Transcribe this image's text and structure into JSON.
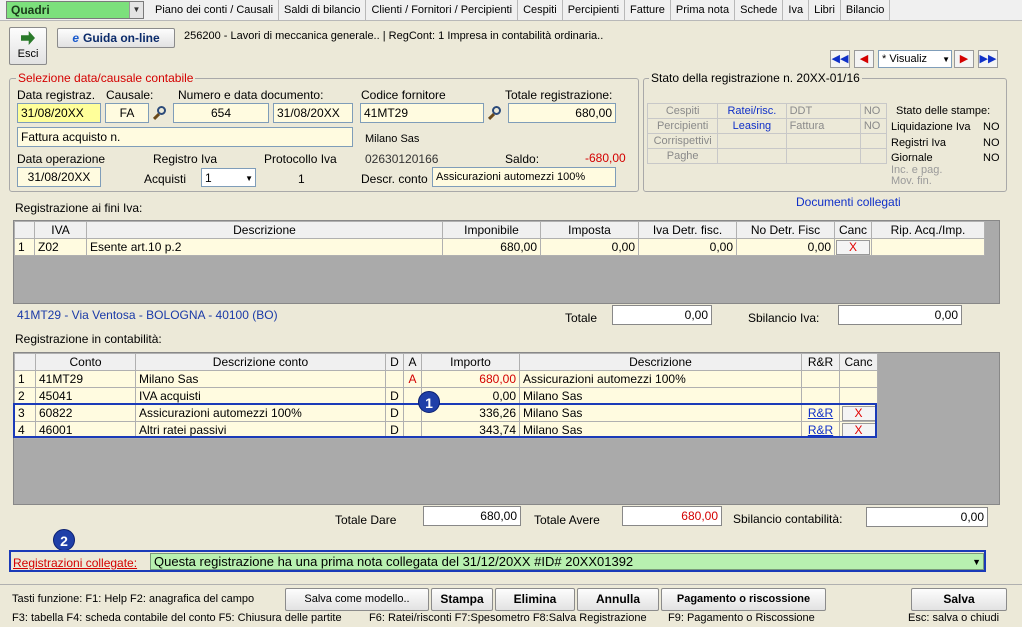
{
  "menubar": {
    "combo_value": "Quadri",
    "items": [
      "Piano dei conti / Causali",
      "Saldi di bilancio",
      "Clienti / Fornitori / Percipienti",
      "Cespiti",
      "Percipienti",
      "Fatture",
      "Prima nota",
      "Schede",
      "Iva",
      "Libri",
      "Bilancio"
    ]
  },
  "toolbar": {
    "esci_label": "Esci",
    "guida_label": "Guida on-line",
    "info_text": "256200 - Lavori di meccanica generale.. | RegCont: 1 Impresa  in contabilità ordinaria..",
    "nav_select": "* Visualiz"
  },
  "selezione": {
    "title": "Selezione data/causale contabile",
    "data_registraz_label": "Data registraz.",
    "data_registraz": "31/08/20XX",
    "causale_label": "Causale:",
    "causale": "FA",
    "numero_data_label": "Numero e data documento:",
    "numero_doc": "654",
    "data_doc": "31/08/20XX",
    "descrizione": "Fattura acquisto n.",
    "data_operazione_label": "Data operazione",
    "data_operazione": "31/08/20XX",
    "registro_iva_label": "Registro Iva",
    "acquisti_label": "Acquisti",
    "registro_iva": "1",
    "protocollo_label": "Protocollo Iva",
    "protocollo": "1",
    "codice_fornitore_label": "Codice fornitore",
    "codice_fornitore": "41MT29",
    "totale_label": "Totale registrazione:",
    "totale": "680,00",
    "fornitore_nome": "Milano Sas",
    "fornitore_piva": "02630120166",
    "saldo_label": "Saldo:",
    "saldo": "-680,00",
    "descr_conto_label": "Descr. conto",
    "descr_conto": "Assicurazioni automezzi 100%"
  },
  "stato": {
    "title": "Stato della registrazione n. 20XX-01/16",
    "rows": [
      [
        "Cespiti",
        "Ratei/risc.",
        "DDT",
        "NO"
      ],
      [
        "Percipienti",
        "Leasing",
        "Fattura",
        "NO"
      ],
      [
        "Corrispettivi",
        "",
        "",
        ""
      ],
      [
        "Paghe",
        "",
        "",
        ""
      ]
    ],
    "stampe_title": "Stato delle stampe:",
    "stampe": [
      [
        "Liquidazione Iva",
        "NO"
      ],
      [
        "Registri Iva",
        "NO"
      ],
      [
        "Giornale",
        "NO"
      ],
      [
        "Inc. e pag. Mov. fin.",
        ""
      ]
    ]
  },
  "iva": {
    "title": "Registrazione ai fini Iva:",
    "documenti_collegati": "Documenti collegati",
    "headers": [
      "",
      "IVA",
      "Descrizione",
      "Imponibile",
      "Imposta",
      "Iva Detr. fisc.",
      "No Detr. Fisc",
      "Canc",
      "Rip. Acq./Imp."
    ],
    "rows": [
      {
        "n": "1",
        "iva": "Z02",
        "desc": "Esente art.10 p.2",
        "imponibile": "680,00",
        "imposta": "0,00",
        "detr": "0,00",
        "nodetr": "0,00",
        "canc": "X"
      }
    ],
    "address": "41MT29 - Via Ventosa - BOLOGNA - 40100 (BO)",
    "totale_label": "Totale",
    "totale": "0,00",
    "sbilancio_label": "Sbilancio Iva:",
    "sbilancio": "0,00"
  },
  "contab": {
    "title": "Registrazione in contabilità:",
    "headers": [
      "",
      "Conto",
      "Descrizione conto",
      "D",
      "A",
      "Importo",
      "Descrizione",
      "R&R",
      "Canc"
    ],
    "rows": [
      {
        "n": "1",
        "conto": "41MT29",
        "desc": "Milano Sas",
        "d": "",
        "a": "A",
        "importo": "680,00",
        "descr": "Assicurazioni automezzi 100%",
        "rr": "",
        "canc": ""
      },
      {
        "n": "2",
        "conto": "45041",
        "desc": "IVA acquisti",
        "d": "D",
        "a": "",
        "importo": "0,00",
        "descr": "Milano Sas",
        "rr": "",
        "canc": ""
      },
      {
        "n": "3",
        "conto": "60822",
        "desc": "Assicurazioni automezzi 100%",
        "d": "D",
        "a": "",
        "importo": "336,26",
        "descr": "Milano Sas",
        "rr": "R&R",
        "canc": "X"
      },
      {
        "n": "4",
        "conto": "46001",
        "desc": "Altri ratei passivi",
        "d": "D",
        "a": "",
        "importo": "343,74",
        "descr": "Milano Sas",
        "rr": "R&R",
        "canc": "X"
      }
    ],
    "badge1": "1",
    "totale_dare_label": "Totale Dare",
    "totale_dare": "680,00",
    "totale_avere_label": "Totale Avere",
    "totale_avere": "680,00",
    "sbilancio_label": "Sbilancio contabilità:",
    "sbilancio": "0,00"
  },
  "collegate": {
    "badge2": "2",
    "label": "Registrazioni collegate:",
    "value": "Questa registrazione ha una prima nota collegata del 31/12/20XX  #ID# 20XX01392"
  },
  "footer": {
    "tasti_line1": "Tasti funzione: F1: Help  F2: anagrafica del campo",
    "tasti_line2": "F3: tabella  F4: scheda contabile del conto  F5: Chiusura delle partite",
    "tasti_line2b": "F6: Ratei/risconti  F7:Spesometro  F8:Salva Registrazione",
    "tasti_line2c": "F9: Pagamento o Riscossione",
    "esc_hint": "Esc: salva o chiudi",
    "salva_modello": "Salva come modello..",
    "stampa": "Stampa",
    "elimina": "Elimina",
    "annulla": "Annulla",
    "pagamento": "Pagamento o riscossione",
    "salva": "Salva"
  }
}
